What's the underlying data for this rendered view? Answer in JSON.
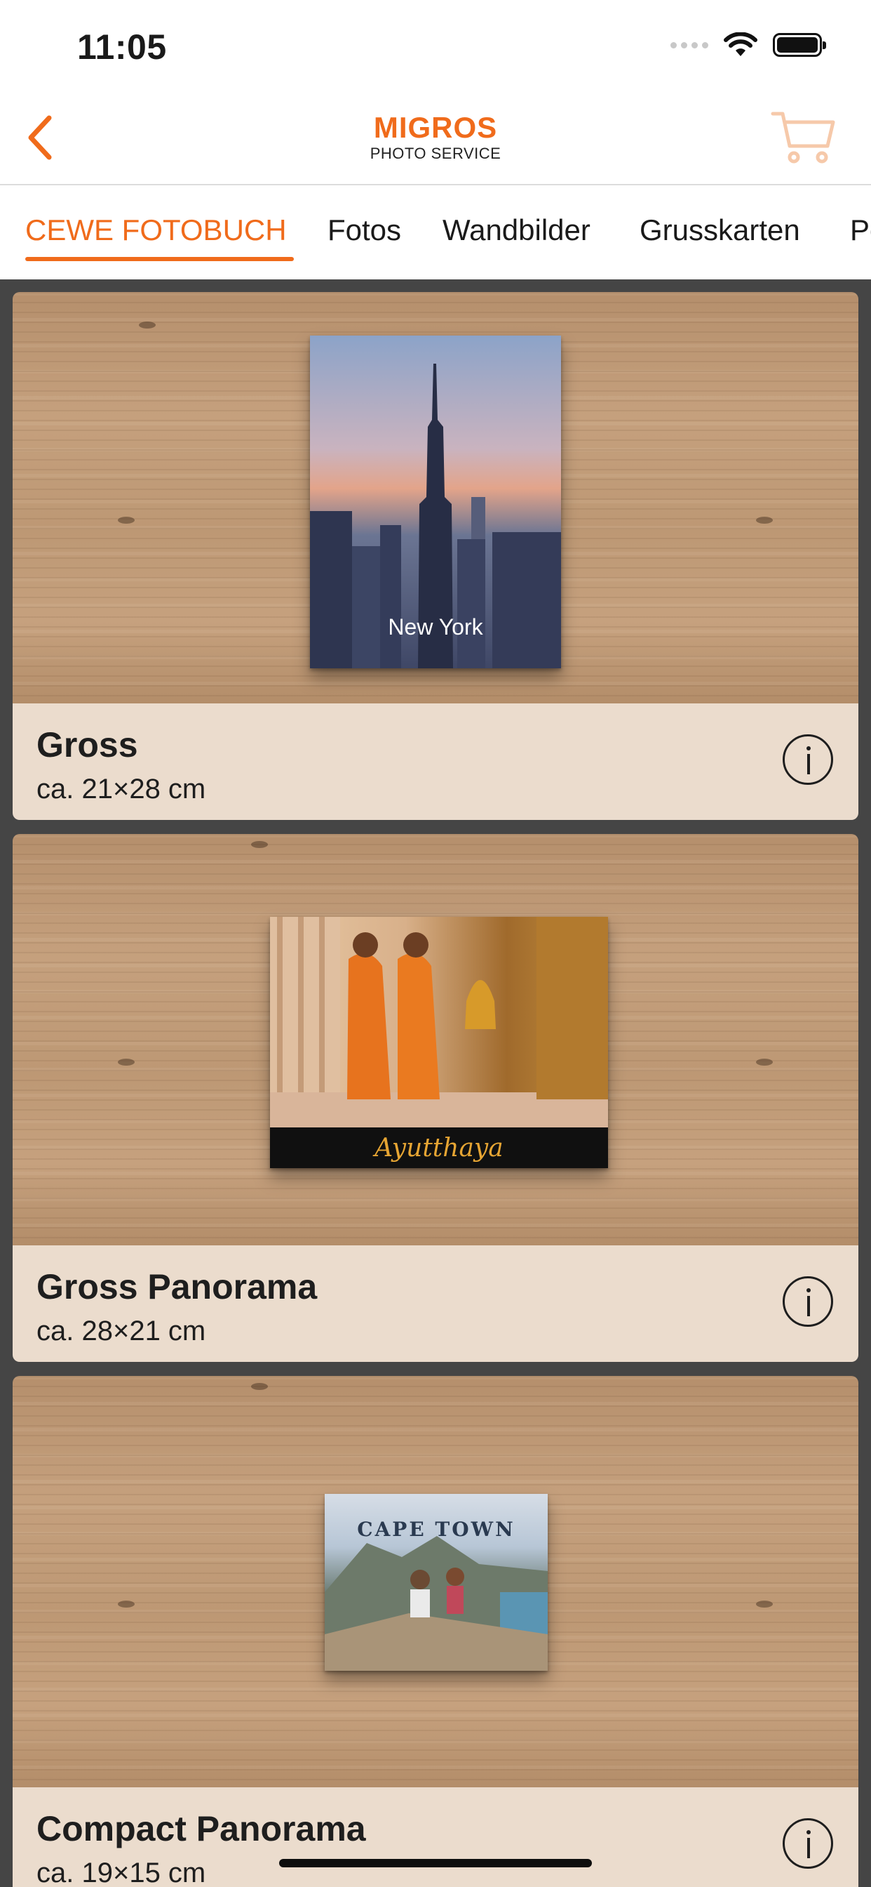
{
  "status_bar": {
    "time": "11:05"
  },
  "brand": {
    "name": "MIGROS",
    "subtitle": "PHOTO SERVICE"
  },
  "tabs": [
    {
      "label": "CEWE FOTOBUCH",
      "active": true
    },
    {
      "label": "Fotos"
    },
    {
      "label": "Wandbilder"
    },
    {
      "label": "Grusskarten"
    },
    {
      "label": "Po"
    }
  ],
  "products": [
    {
      "title": "Gross",
      "size": "ca. 21×28 cm",
      "cover_text": "New York"
    },
    {
      "title": "Gross Panorama",
      "size": "ca. 28×21 cm",
      "cover_text": "Ayutthaya"
    },
    {
      "title": "Compact Panorama",
      "size": "ca. 19×15 cm",
      "cover_text": "CAPE TOWN"
    }
  ],
  "colors": {
    "accent": "#f06b1b",
    "footer": "#ebdccd",
    "background": "#454545"
  },
  "icons": {
    "back": "chevron-left-icon",
    "cart": "cart-icon",
    "info": "info-icon"
  }
}
